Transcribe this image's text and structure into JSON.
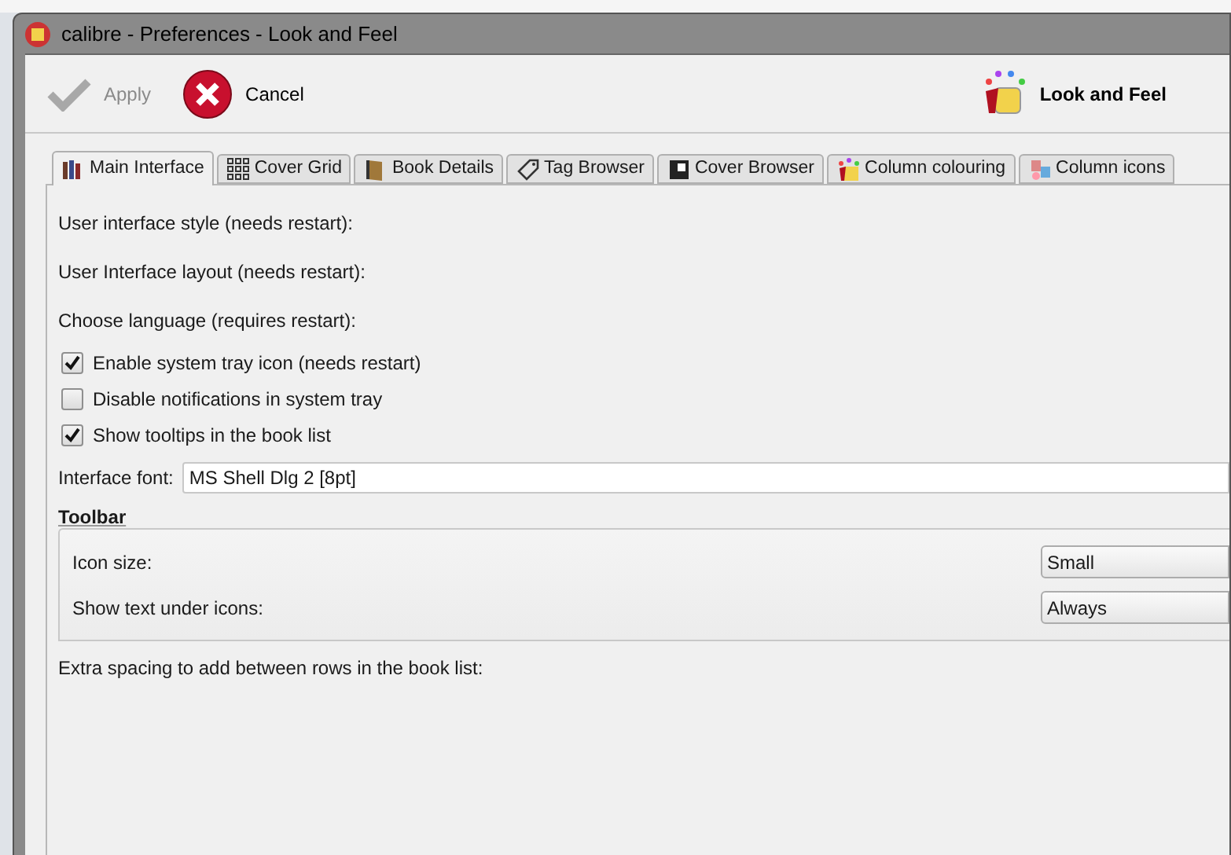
{
  "window": {
    "title": "calibre - Preferences - Look and Feel"
  },
  "toolbar": {
    "buttons": [
      {
        "kind": "apply",
        "label": "Apply",
        "disabled": true
      },
      {
        "kind": "cancel",
        "label": "Cancel",
        "disabled": false
      }
    ],
    "section_title": "Look and Feel"
  },
  "tabs": [
    {
      "label": "Main Interface",
      "kind": "books",
      "selected": true
    },
    {
      "label": "Cover Grid",
      "kind": "grid",
      "selected": false
    },
    {
      "label": "Book Details",
      "kind": "book",
      "selected": false
    },
    {
      "label": "Tag Browser",
      "kind": "tag",
      "selected": false
    },
    {
      "label": "Cover Browser",
      "kind": "cover",
      "selected": false
    },
    {
      "label": "Column colouring",
      "kind": "paint",
      "selected": false
    },
    {
      "label": "Column icons",
      "kind": "icons",
      "selected": false
    }
  ],
  "fields": [
    {
      "kind": "label",
      "label": "User interface style (needs restart):"
    },
    {
      "kind": "label",
      "label": "User Interface layout (needs restart):"
    },
    {
      "kind": "label",
      "label": "Choose language (requires restart):"
    },
    {
      "kind": "checkbox",
      "label": "Enable system tray icon (needs restart)",
      "checked": true
    },
    {
      "kind": "checkbox",
      "label": "Disable notifications in system tray",
      "checked": false
    },
    {
      "kind": "checkbox",
      "label": "Show tooltips in the book list",
      "checked": true
    },
    {
      "kind": "input",
      "label": "Interface font:",
      "value": "MS Shell Dlg 2 [8pt]"
    }
  ],
  "toolbar_group": {
    "title": "Toolbar",
    "rows": [
      {
        "label": "Icon size:",
        "value": "Small"
      },
      {
        "label": "Show text under icons:",
        "value": "Always"
      }
    ]
  },
  "footer_label": "Extra spacing to add between rows in the book list:"
}
